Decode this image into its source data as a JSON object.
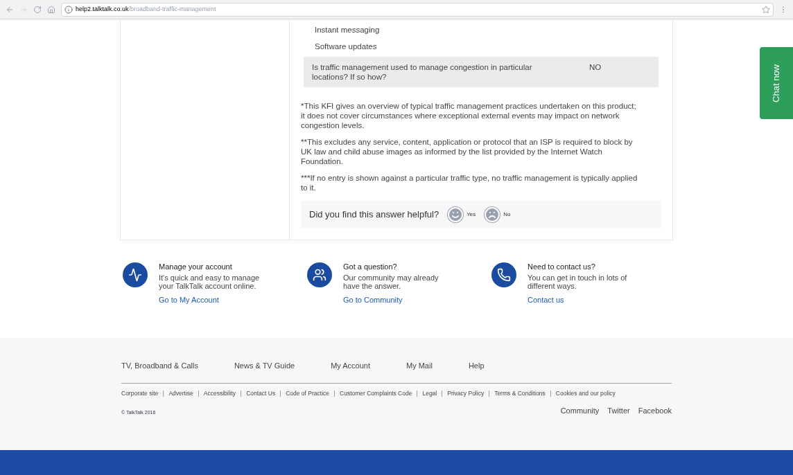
{
  "browser": {
    "url_host": "help2.talktalk.co.uk",
    "url_path": "/broadband-traffic-management"
  },
  "traffic_types": [
    "Instant messaging",
    "Software updates"
  ],
  "question": {
    "text": "Is traffic management used to manage congestion in particular locations? If so how?",
    "answer": "NO"
  },
  "notes": [
    "*This KFI gives an overview of typical traffic management practices undertaken on this product; it does not cover circumstances where exceptional external events may impact on network congestion levels.",
    "**This excludes any service, content, application or protocol that an ISP is required to block by UK law and child abuse images as informed by the list provided by the Internet Watch Foundation.",
    "***If no entry is shown against a particular traffic type, no traffic management is typically applied to it."
  ],
  "feedback": {
    "question": "Did you find this answer helpful?",
    "options": [
      {
        "label": "Yes",
        "kind": "happy"
      },
      {
        "label": "No",
        "kind": "sad"
      }
    ]
  },
  "help_cards": [
    {
      "kind": "pulse",
      "title": "Manage your account",
      "text": "It's quick and easy to manage your TalkTalk account online.",
      "link": "Go to My Account"
    },
    {
      "kind": "people",
      "title": "Got a question?",
      "text": "Our community may already have the answer.",
      "link": "Go to Community"
    },
    {
      "kind": "phone",
      "title": "Need to contact us?",
      "text": "You can get in touch in lots of different ways.",
      "link": "Contact us"
    }
  ],
  "footer": {
    "nav": [
      "TV, Broadband & Calls",
      "News & TV Guide",
      "My Account",
      "My Mail",
      "Help"
    ],
    "links": [
      "Corporate site",
      "Advertise",
      "Accessibility",
      "Contact Us",
      "Code of Practice",
      "Customer Complaints Code",
      "Legal",
      "Privacy Policy",
      "Terms & Conditions",
      "Cookies and our policy"
    ],
    "social": [
      "Community",
      "Twitter",
      "Facebook"
    ],
    "copyright": "© TalkTalk 2016"
  },
  "chat_tab": "Chat now"
}
